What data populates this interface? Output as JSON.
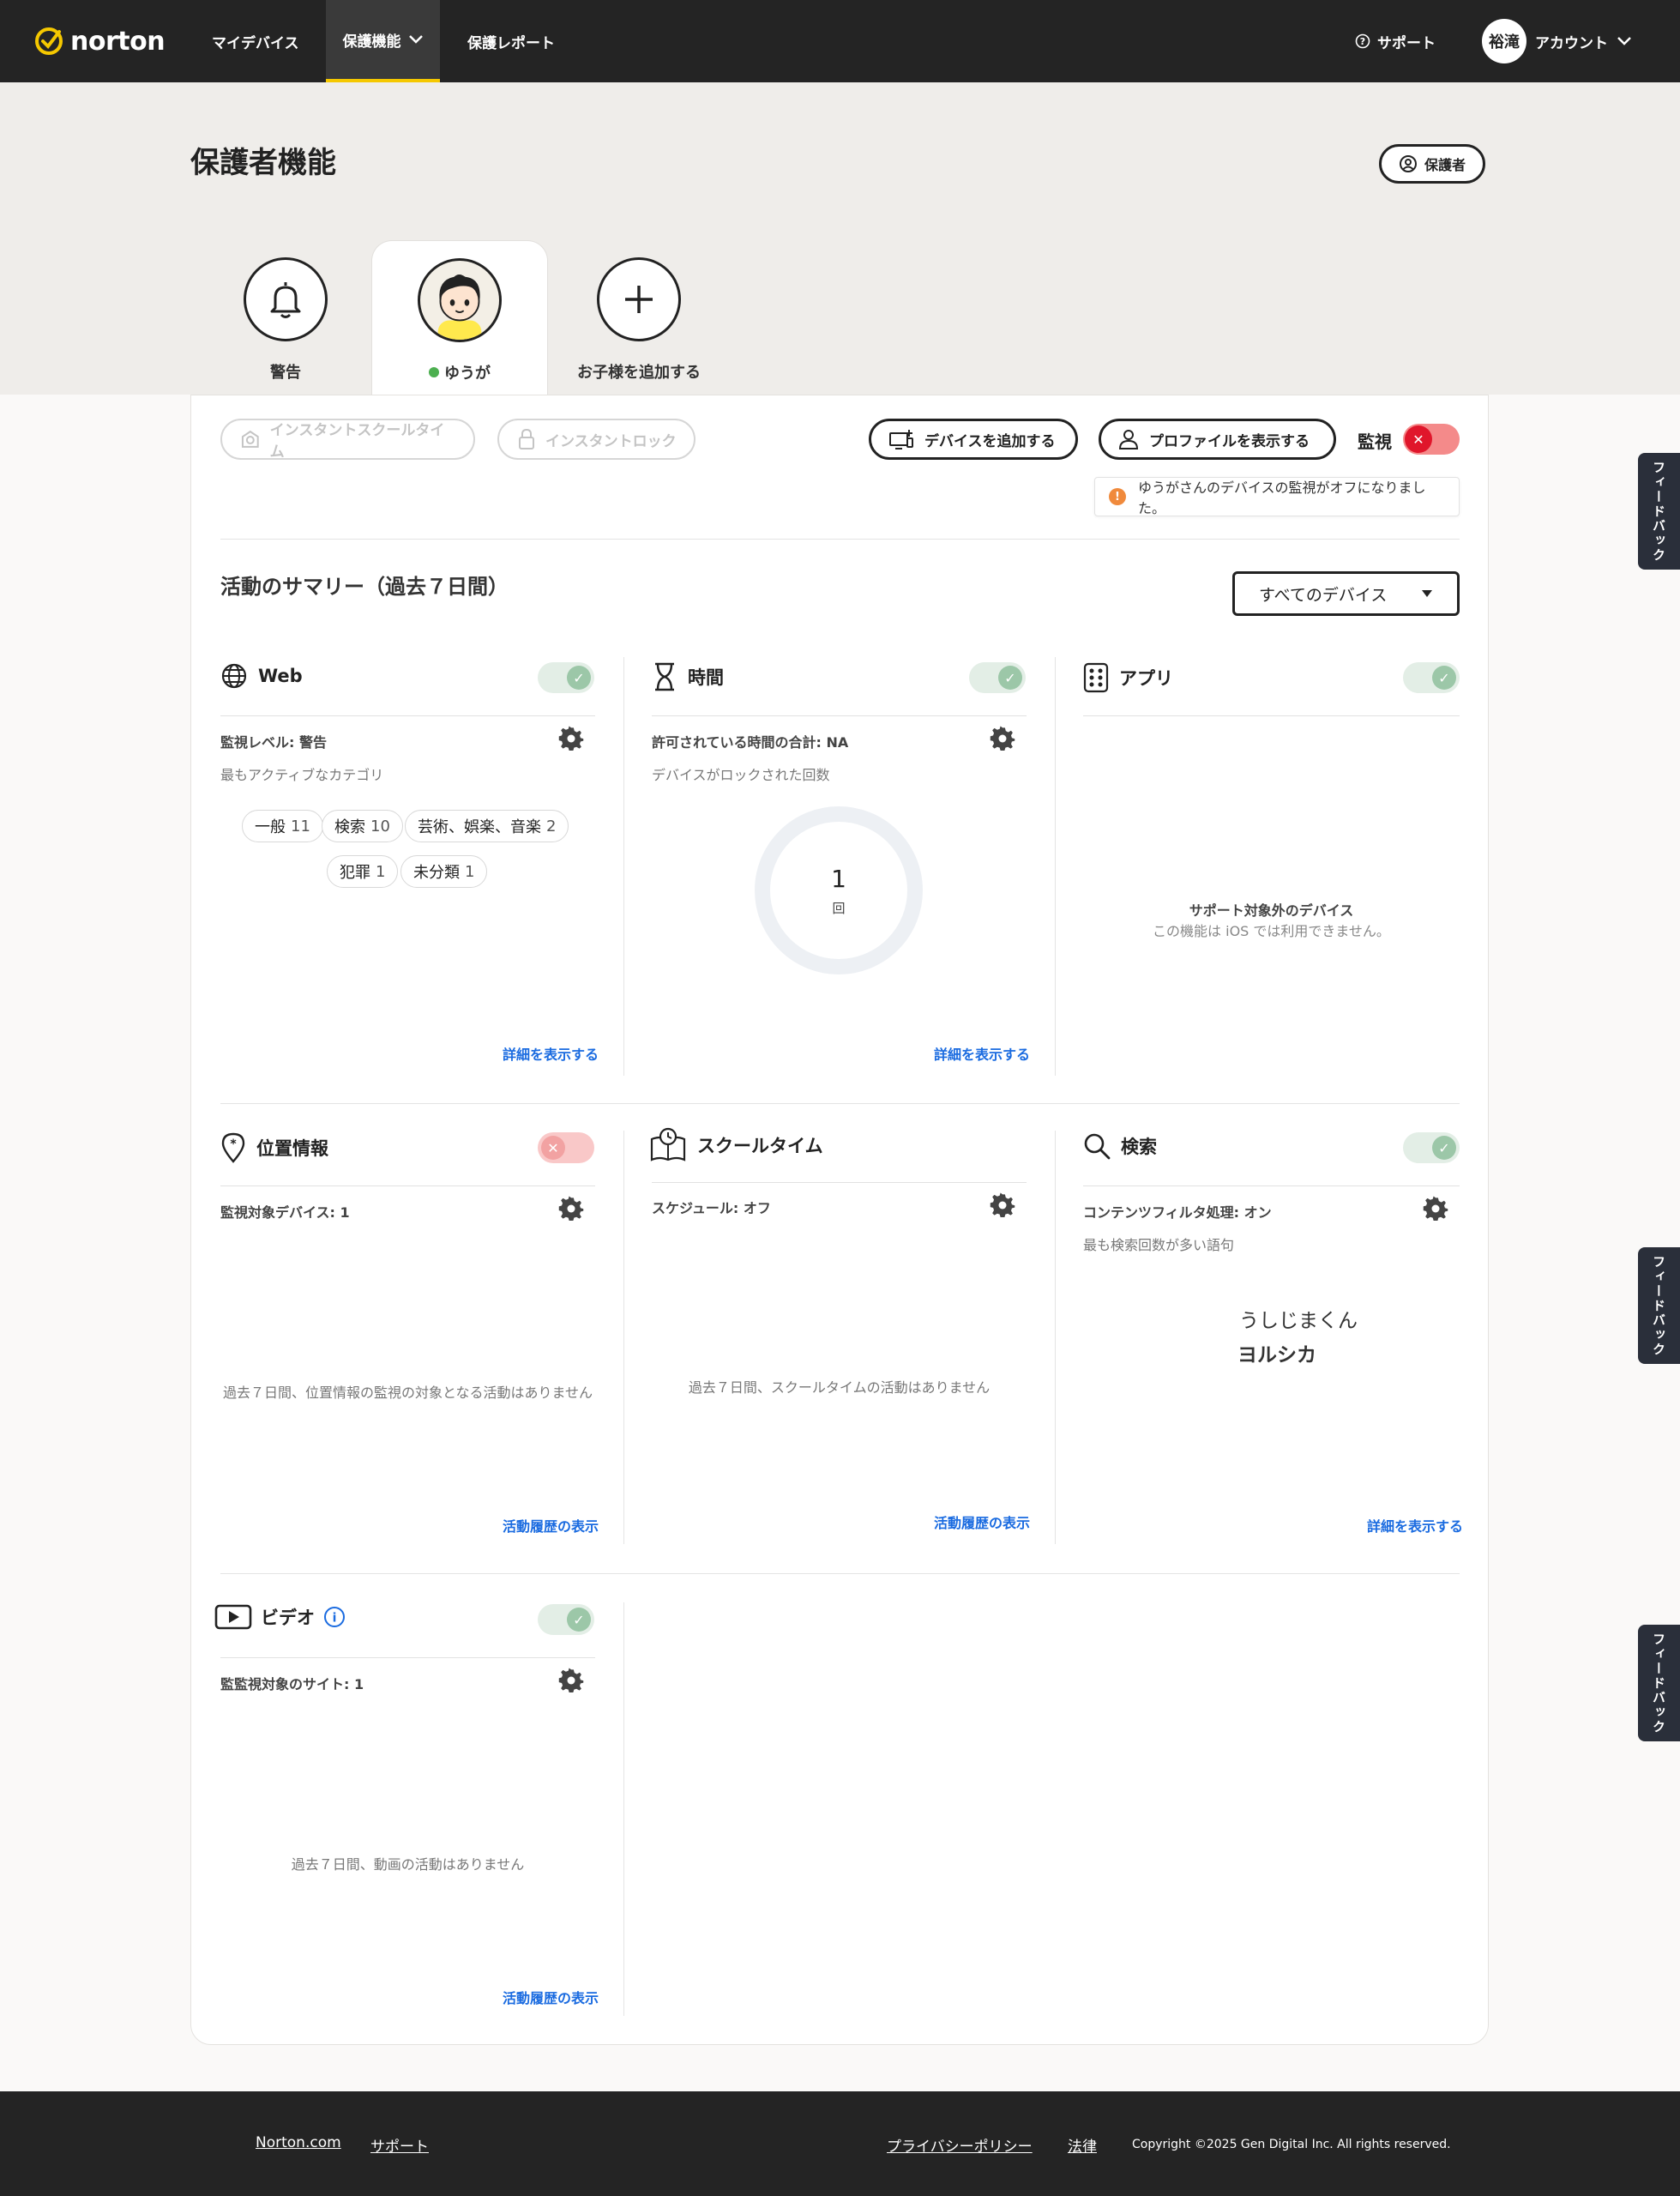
{
  "nav": {
    "brand": "norton",
    "items": [
      "マイデバイス",
      "保護機能",
      "保護レポート"
    ],
    "support": "サポート",
    "account_initials": "裕滝",
    "account": "アカウント"
  },
  "header": {
    "title": "保護者機能",
    "guardian_button": "保護者",
    "tabs": {
      "alerts": "警告",
      "child": "ゆうが",
      "add_child": "お子様を追加する"
    }
  },
  "actions": {
    "instant_school_time": "インスタントスクールタイム",
    "instant_lock": "インスタントロック",
    "add_device": "デバイスを追加する",
    "view_profile": "プロファイルを表示する",
    "monitor_label": "監視",
    "warning": "ゆうがさんのデバイスの監視がオフになりました。"
  },
  "summary": {
    "title": "活動のサマリー（過去７日間）",
    "device_filter": "すべてのデバイス"
  },
  "cards": {
    "web": {
      "title": "Web",
      "level": "監視レベル: 警告",
      "note": "最もアクティブなカテゴリ",
      "chips": [
        {
          "label": "一般",
          "count": "11"
        },
        {
          "label": "検索",
          "count": "10"
        },
        {
          "label": "芸術、娯楽、音楽",
          "count": "2"
        },
        {
          "label": "犯罪",
          "count": "1"
        },
        {
          "label": "未分類",
          "count": "1"
        }
      ],
      "link": "詳細を表示する"
    },
    "time": {
      "title": "時間",
      "allowed": "許可されている時間の合計: NA",
      "note": "デバイスがロックされた回数",
      "lock_count": "1",
      "lock_unit": "回",
      "link": "詳細を表示する"
    },
    "apps": {
      "title": "アプリ",
      "unsupported_title": "サポート対象外のデバイス",
      "unsupported_note": "この機能は iOS では利用できません。"
    },
    "location": {
      "title": "位置情報",
      "devices": "監視対象デバイス: 1",
      "empty": "過去７日間、位置情報の監視の対象となる活動はありません",
      "link": "活動履歴の表示"
    },
    "school": {
      "title": "スクールタイム",
      "schedule": "スケジュール: オフ",
      "empty": "過去７日間、スクールタイムの活動はありません",
      "link": "活動履歴の表示"
    },
    "search": {
      "title": "検索",
      "filter": "コンテンツフィルタ処理: オン",
      "note": "最も検索回数が多い語句",
      "terms": [
        "うしじまくん",
        "ヨルシカ"
      ],
      "link": "詳細を表示する"
    },
    "video": {
      "title": "ビデオ",
      "sites": "監監視対象のサイト: 1",
      "empty": "過去７日間、動画の活動はありません",
      "link": "活動履歴の表示"
    }
  },
  "feedback": "フィードバック",
  "footer": {
    "links": [
      "Norton.com",
      "サポート",
      "プライバシーポリシー",
      "法律"
    ],
    "copyright": "Copyright ©2025 Gen Digital Inc. All rights reserved."
  },
  "colors": {
    "nav_bg": "#242424",
    "accent": "#f5c800",
    "link": "#1a6be0",
    "toggle_off": "#e0162b",
    "warning": "#f08a3c"
  }
}
